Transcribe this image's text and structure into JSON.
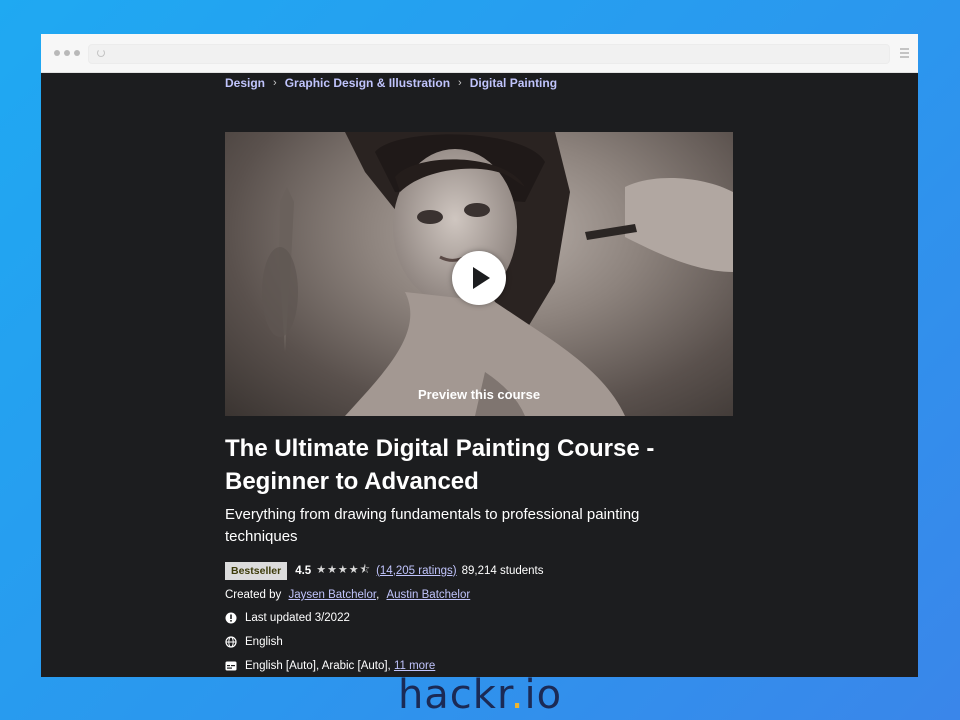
{
  "breadcrumb": [
    {
      "label": "Design"
    },
    {
      "label": "Graphic Design & Illustration"
    },
    {
      "label": "Digital Painting"
    }
  ],
  "preview": {
    "label": "Preview this course"
  },
  "course": {
    "title_line1": "The Ultimate Digital Painting Course -",
    "title_line2": "Beginner to Advanced",
    "subtitle_line1": "Everything from drawing fundamentals to professional painting",
    "subtitle_line2": "techniques",
    "badge": "Bestseller",
    "rating": "4.5",
    "stars": "★★★★⯪",
    "ratings_count": "(14,205 ratings)",
    "students": "89,214 students",
    "created_by_label": "Created by",
    "instructor1": "Jaysen Batchelor",
    "instructor2": "Austin Batchelor",
    "last_updated": "Last updated 3/2022",
    "language": "English",
    "captions": "English [Auto], Arabic [Auto],",
    "captions_more": "11 more"
  },
  "watermark": {
    "text_main": "hackr",
    "text_dot": ".",
    "text_end": "io"
  },
  "colors": {
    "background": "#2b97ee",
    "page": "#1c1d1f",
    "link": "#c0c4fc",
    "badge": "#dcdcdc",
    "logo": "#1b2a55",
    "logo_accent": "#f1b52d"
  },
  "icons": [
    "reload-icon",
    "menu-icon",
    "play-icon",
    "alert-badge-icon",
    "globe-icon",
    "captions-icon"
  ]
}
